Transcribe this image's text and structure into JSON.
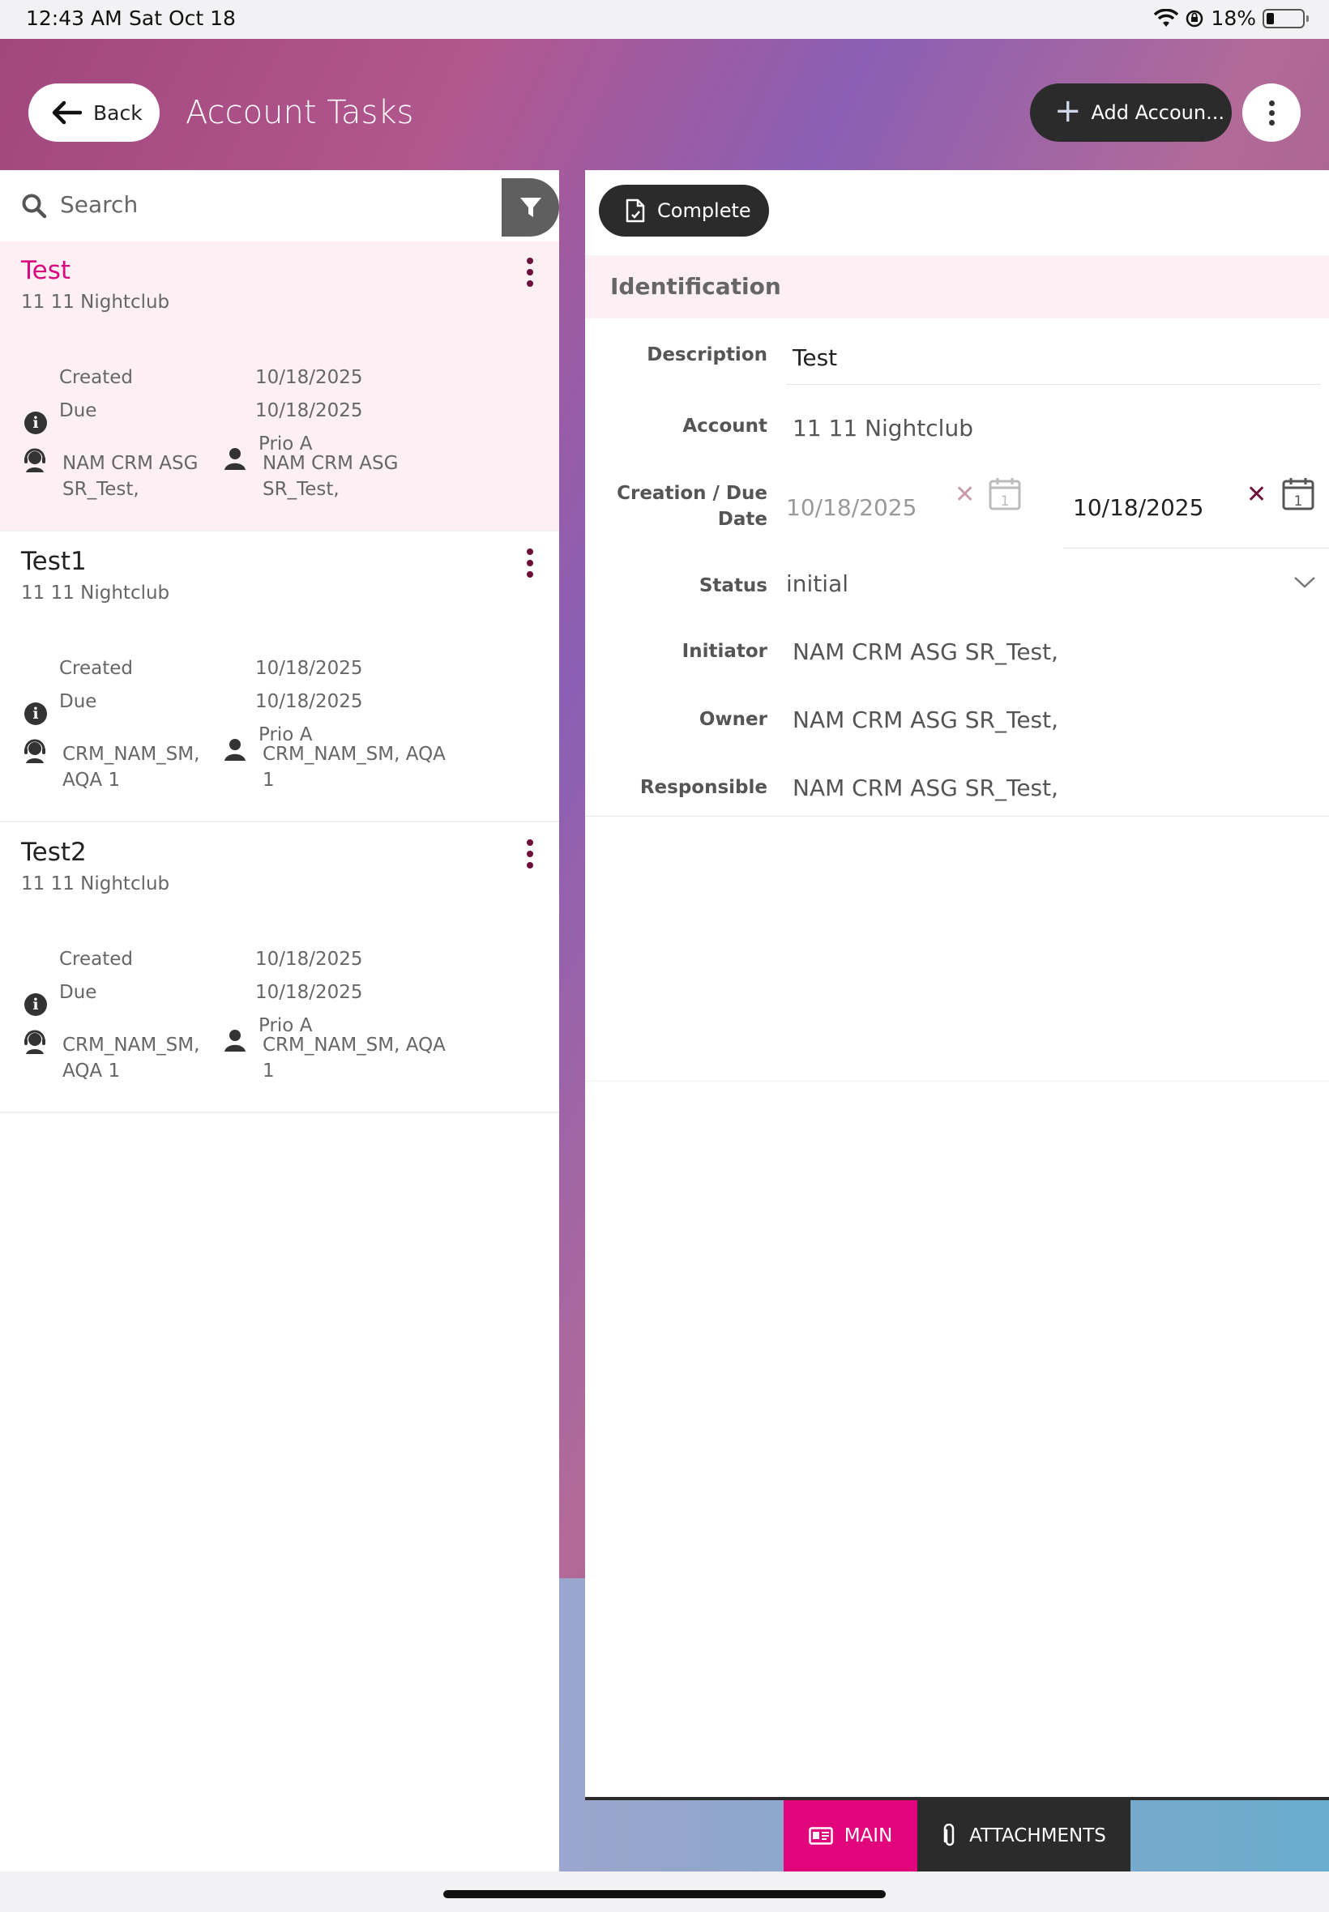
{
  "status_bar": {
    "time": "12:43 AM",
    "date": "Sat Oct 18",
    "battery": "18%"
  },
  "header": {
    "back_label": "Back",
    "title": "Account Tasks",
    "add_label": "Add Accoun..."
  },
  "search": {
    "placeholder": "Search"
  },
  "labels": {
    "created": "Created",
    "due": "Due"
  },
  "tasks": [
    {
      "title": "Test",
      "account": "11 11 Nightclub",
      "created": "10/18/2025",
      "due": "10/18/2025",
      "priority": "Prio A",
      "initiator": "NAM CRM ASG SR_Test,",
      "owner": "NAM CRM ASG SR_Test,"
    },
    {
      "title": "Test1",
      "account": "11 11 Nightclub",
      "created": "10/18/2025",
      "due": "10/18/2025",
      "priority": "Prio A",
      "initiator": "CRM_NAM_SM, AQA 1",
      "owner": "CRM_NAM_SM, AQA 1"
    },
    {
      "title": "Test2",
      "account": "11 11 Nightclub",
      "created": "10/18/2025",
      "due": "10/18/2025",
      "priority": "Prio A",
      "initiator": "CRM_NAM_SM, AQA 1",
      "owner": "CRM_NAM_SM, AQA 1"
    }
  ],
  "detail": {
    "complete_label": "Complete",
    "section_title": "Identification",
    "fields": {
      "description": {
        "label": "Description",
        "value": "Test"
      },
      "account": {
        "label": "Account",
        "value": "11 11 Nightclub"
      },
      "dates": {
        "label": "Creation / Due Date",
        "creation": "10/18/2025",
        "due": "10/18/2025"
      },
      "status": {
        "label": "Status",
        "value": "initial"
      },
      "initiator": {
        "label": "Initiator",
        "value": "NAM CRM ASG SR_Test,"
      },
      "owner": {
        "label": "Owner",
        "value": "NAM CRM ASG SR_Test,"
      },
      "responsible": {
        "label": "Responsible",
        "value": "NAM CRM ASG SR_Test,"
      }
    },
    "calendar_day": "1"
  },
  "tabs": {
    "main": "MAIN",
    "attachments": "ATTACHMENTS"
  },
  "colors": {
    "accent": "#e2067c",
    "dark": "#2b2b2b",
    "selected_bg": "#fcf0f5",
    "kebab": "#6e0f3a"
  }
}
